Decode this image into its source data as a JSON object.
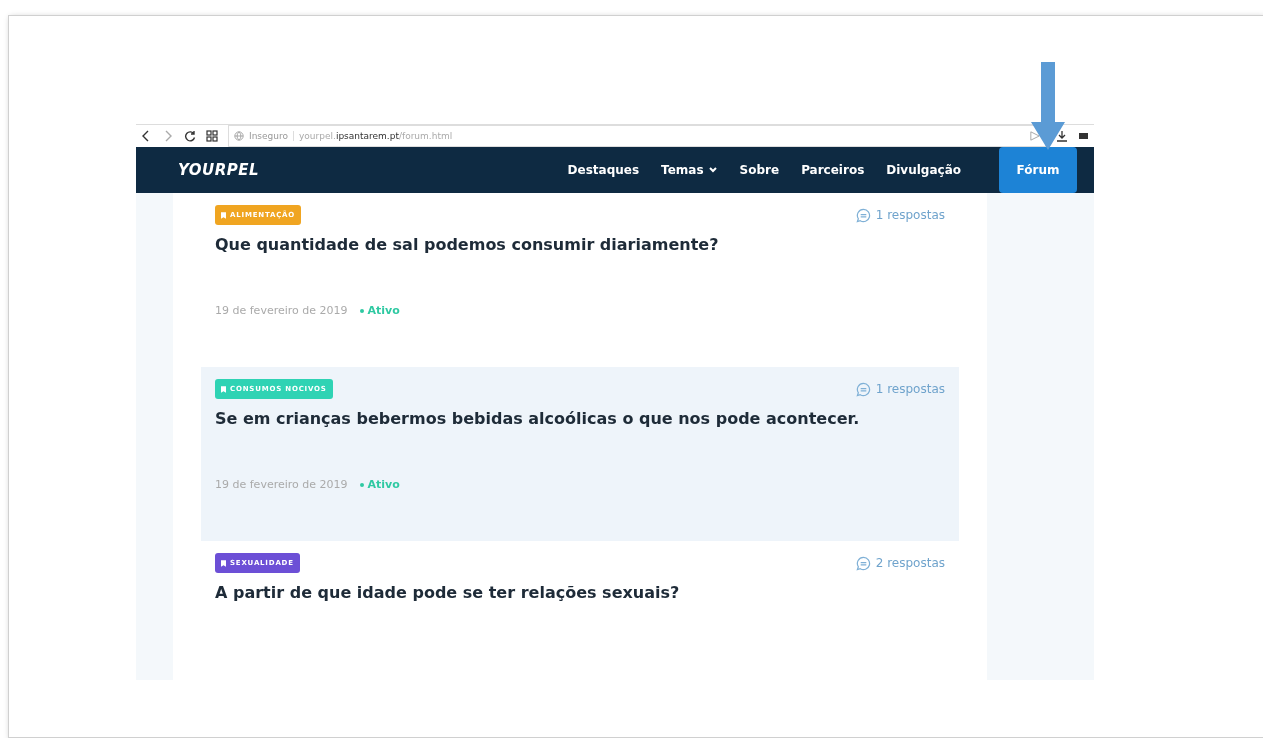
{
  "browser": {
    "security": "Inseguro",
    "url": "yourpel.**ipsantarem.pt**/forum.html"
  },
  "navbar": {
    "logo": "YOURPEL",
    "links": [
      {
        "label": "Destaques",
        "dropdown": false
      },
      {
        "label": "Temas",
        "dropdown": true
      },
      {
        "label": "Sobre",
        "dropdown": false
      },
      {
        "label": "Parceiros",
        "dropdown": false
      },
      {
        "label": "Divulgação",
        "dropdown": false
      }
    ],
    "button": "Fórum"
  },
  "topics": [
    {
      "tag": "ALIMENTAÇÃO",
      "color": "#f0a521",
      "replies": "1 respostas",
      "title": "Que quantidade de sal podemos consumir diariamente?",
      "date": "19 de fevereiro de 2019",
      "status": "Ativo",
      "highlighted": false
    },
    {
      "tag": "CONSUMOS NOCIVOS",
      "color": "#2fd3b4",
      "replies": "1 respostas",
      "title": "Se em crianças bebermos bebidas alcoólicas o que nos pode acontecer.",
      "date": "19 de fevereiro de 2019",
      "status": "Ativo",
      "highlighted": true
    },
    {
      "tag": "SEXUALIDADE",
      "color": "#6c4fd6",
      "replies": "2 respostas",
      "title": "A partir de que idade pode se ter relações sexuais?",
      "highlighted": false
    }
  ]
}
